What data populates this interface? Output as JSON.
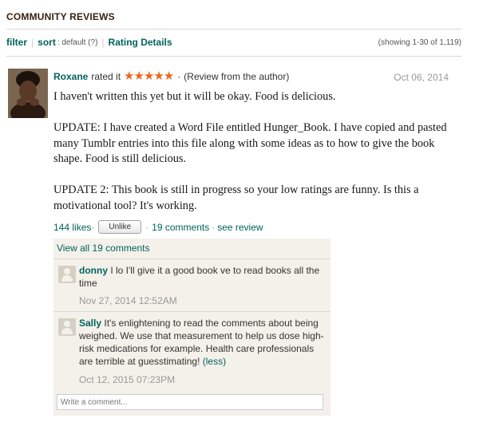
{
  "section": {
    "title": "COMMUNITY REVIEWS"
  },
  "filterbar": {
    "filter_label": "filter",
    "sort_label": "sort",
    "sort_value": ": default (?)",
    "rating_details_label": "Rating Details",
    "showing_text": "(showing 1-30 of 1,119)"
  },
  "review": {
    "reviewer": "Roxane",
    "rated_text": "rated it",
    "stars": "★★★★★",
    "separator": "·",
    "author_note": "(Review from the author)",
    "date": "Oct 06, 2014",
    "paragraphs": [
      "I haven't written this yet but it will be okay. Food is delicious.",
      "UPDATE: I have created a Word File entitled Hunger_Book. I have copied and pasted many Tumblr entries into this file along with some ideas as to how to give the book shape. Food is still delicious.",
      "UPDATE 2: This book is still in progress so your low ratings are funny. Is this a motivational tool? It's working."
    ],
    "likes": "144 likes",
    "unlike_label": "Unlike",
    "comments_link": "19 comments",
    "see_review_link": "see review"
  },
  "comments": {
    "view_all": "View all 19 comments",
    "items": [
      {
        "author": "donny",
        "text": " I lo I'll give it a good book ve to read books all the time",
        "date": "Nov 27, 2014 12:52AM",
        "less": ""
      },
      {
        "author": "Sally",
        "text": " It's enlightening to read the comments about being weighed. We use that measurement to help us dose high-risk medications for example. Health care professionals are terrible at guesstimating! ",
        "date": "Oct 12, 2015 07:23PM",
        "less": "(less)"
      }
    ],
    "input_placeholder": "Write a comment..."
  },
  "colors": {
    "link": "#00635d",
    "stars": "#f1651a",
    "comment_bg": "#f4f1ea",
    "heading": "#382110"
  }
}
